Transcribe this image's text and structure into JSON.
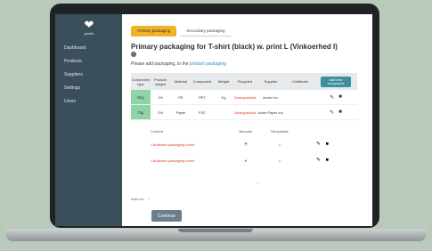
{
  "sidebar": {
    "logo_text": "gentle",
    "items": [
      {
        "label": "Dashboard"
      },
      {
        "label": "Products"
      },
      {
        "label": "Suppliers"
      },
      {
        "label": "Settings"
      },
      {
        "label": "Users"
      }
    ]
  },
  "tabs": [
    {
      "label": "Primary packaging"
    },
    {
      "label": "Secondary packaging"
    }
  ],
  "page": {
    "title": "Primary packaging for T-shirt (black) w. print L (Vinkoerhed I)",
    "subtitle_prefix": "Please add packaging, to the ",
    "subtitle_link": "product packaging",
    "info_glyph": "i"
  },
  "table": {
    "headers": [
      "Component type",
      "Product weight",
      "Material",
      "Component",
      "Weight",
      "Recycled",
      "Supplier",
      "Certificate"
    ],
    "add_button_label": "Add new component",
    "rows": [
      {
        "type": "Bag",
        "weight": "1%",
        "material": "PE",
        "component": "PET",
        "unit": "Kg",
        "recycled": "Biodegradable",
        "supplier": "Acme Inc.",
        "certificate": ""
      },
      {
        "type": "Tag",
        "weight": "2%",
        "material": "Paper",
        "component": "FSC",
        "unit": "",
        "recycled": "Biodegradable",
        "supplier": "Acme Paper Inc.",
        "certificate": ""
      }
    ]
  },
  "subtable": {
    "headers": [
      "Content",
      "Barcode",
      "Recyclable"
    ],
    "rows": [
      {
        "content": "Cardboard packaging insert",
        "barcode": "⦿",
        "recyclable": "•"
      },
      {
        "content": "Cardboard packaging insert",
        "barcode": "✔",
        "recyclable": "•"
      }
    ],
    "footnote": "+"
  },
  "add_row": {
    "label": "Add row",
    "plus": "+"
  },
  "continue_label": "Continue",
  "icons": {
    "edit": "✎",
    "delete": "■"
  },
  "colors": {
    "sidebar": "#3b4f5a",
    "active_tab": "#f3b127",
    "green_cell": "#8fd4a8",
    "cyan_button": "#3c8f9c",
    "continue_button": "#6a7f8b"
  }
}
